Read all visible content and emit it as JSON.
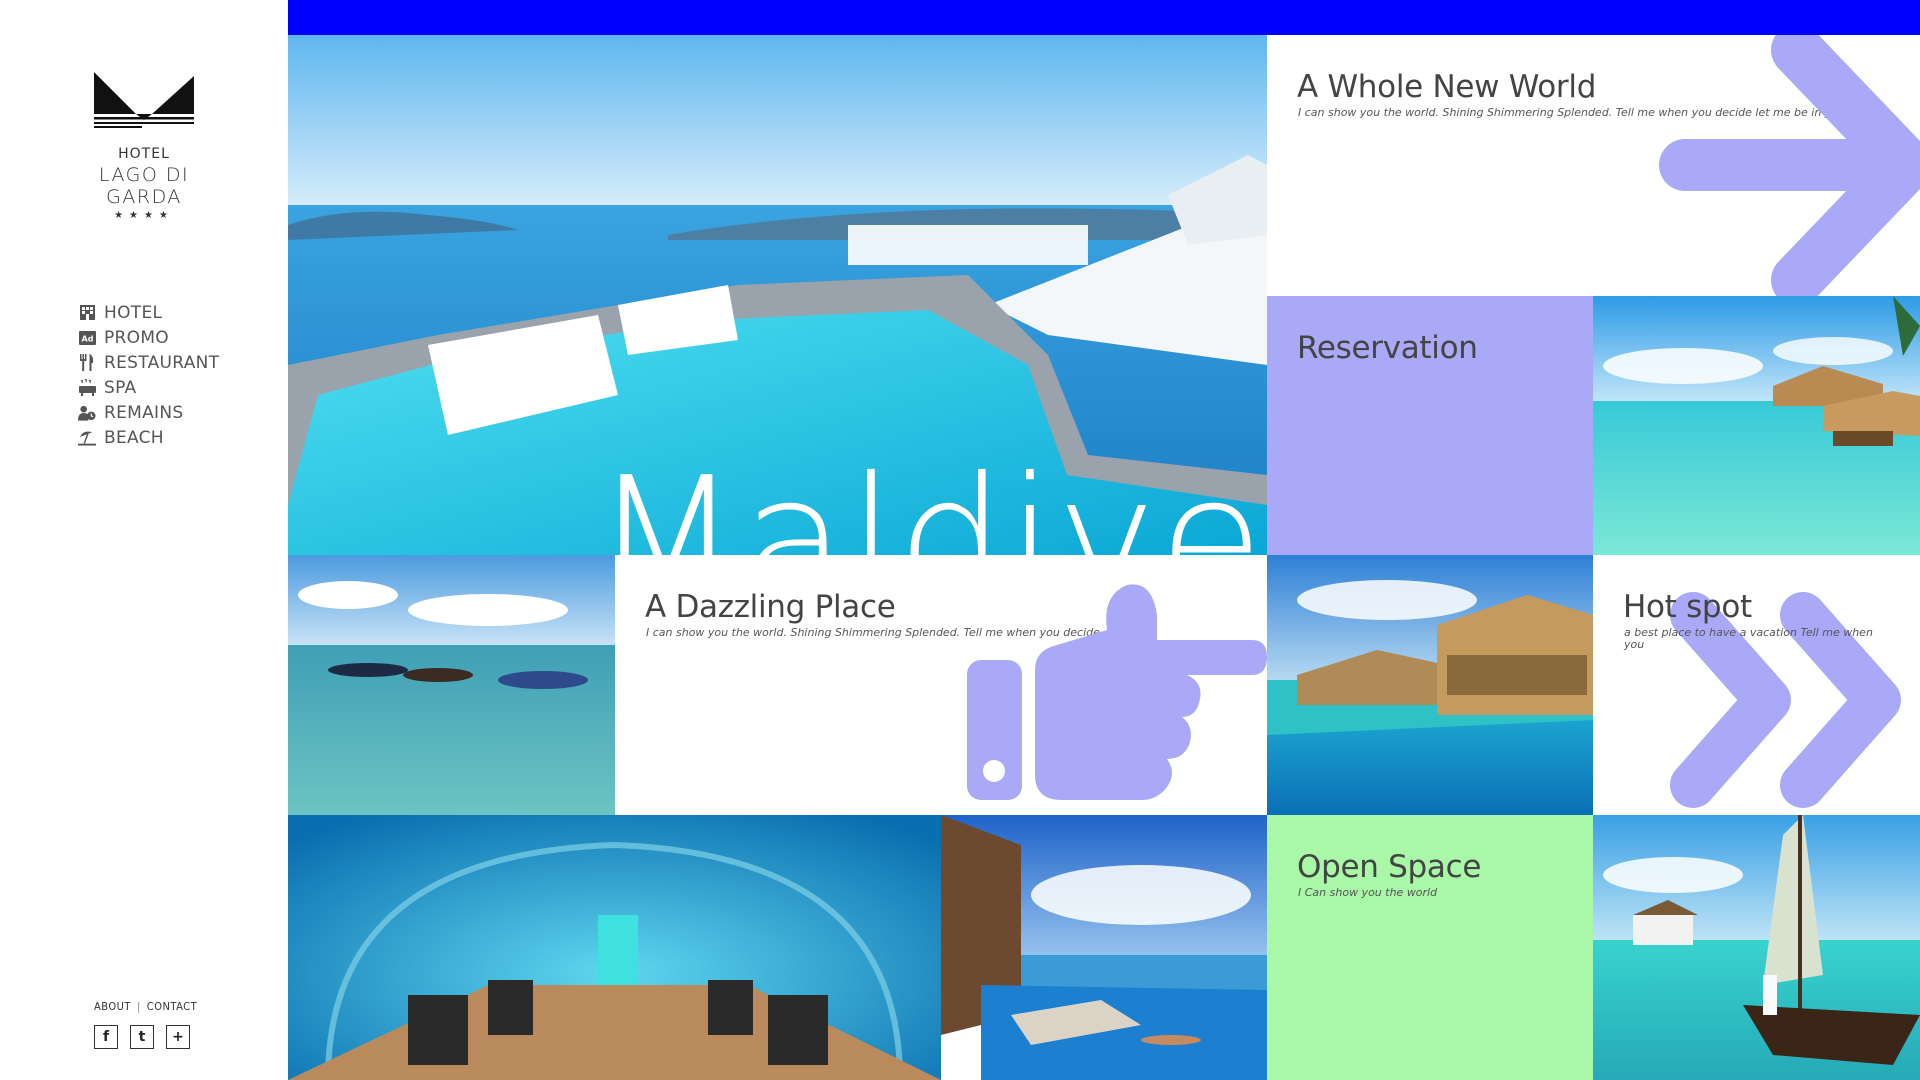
{
  "brand": {
    "hotel_word": "HOTEL",
    "name": "LAGO DI GARDA",
    "stars": "★★★★"
  },
  "nav": [
    {
      "label": "HOTEL",
      "icon": "building-icon"
    },
    {
      "label": "PROMO",
      "icon": "ad-icon"
    },
    {
      "label": "RESTAURANT",
      "icon": "fork-knife-icon"
    },
    {
      "label": "SPA",
      "icon": "spa-icon"
    },
    {
      "label": "REMAINS",
      "icon": "user-clock-icon"
    },
    {
      "label": "BEACH",
      "icon": "umbrella-beach-icon"
    }
  ],
  "footer": {
    "about": "ABOUT",
    "sep": "|",
    "contact": "CONTACT",
    "social": {
      "facebook": "f",
      "twitter": "t",
      "plus": "+"
    }
  },
  "hero": {
    "word": "Maldives"
  },
  "tiles": {
    "world": {
      "title": "A Whole New World",
      "desc": "I can show you the world. Shining Shimmering Splended. Tell me when you decide let me be in your heart."
    },
    "reservation": {
      "title": "Reservation"
    },
    "dazzle": {
      "title": "A Dazzling Place",
      "desc": "I can show you the world. Shining Shimmering Splended. Tell me when you decide ."
    },
    "hotspot": {
      "title": "Hot spot",
      "desc": "a best place to have a vacation Tell me when you"
    },
    "open": {
      "title": "Open Space",
      "desc": "I Can show you the world"
    }
  },
  "colors": {
    "topbar": "#0000ff",
    "lavender": "#a9a9f8",
    "mint": "#a8f8a8",
    "icon_overlay": "#a9a9f8"
  }
}
